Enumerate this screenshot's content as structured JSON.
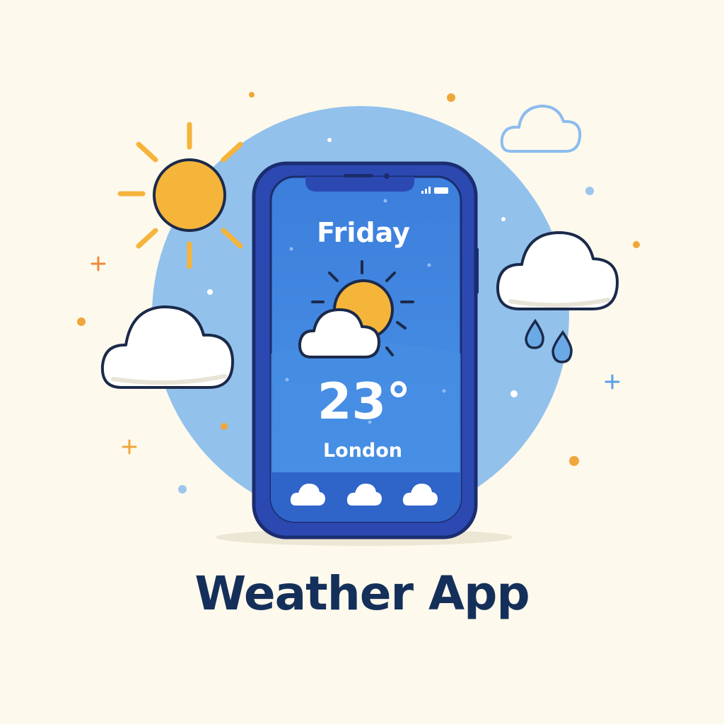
{
  "phone_screen": {
    "day": "Friday",
    "temperature": "23°",
    "city": "London",
    "current_condition_icon": "partly-cloudy-icon",
    "forecast_icons": [
      "cloud-icon",
      "cloud-icon",
      "cloud-icon"
    ]
  },
  "title": "Weather App",
  "colors": {
    "background": "#fdf9ec",
    "backdrop_circle": "#92c1ec",
    "phone_frame": "#2c49b2",
    "phone_outline": "#1b2d6e",
    "screen": "#3f86e0",
    "sun": "#f5b43a",
    "title": "#14305a",
    "accent_orange": "#f0a63a",
    "accent_blue": "#6aa9e6"
  }
}
